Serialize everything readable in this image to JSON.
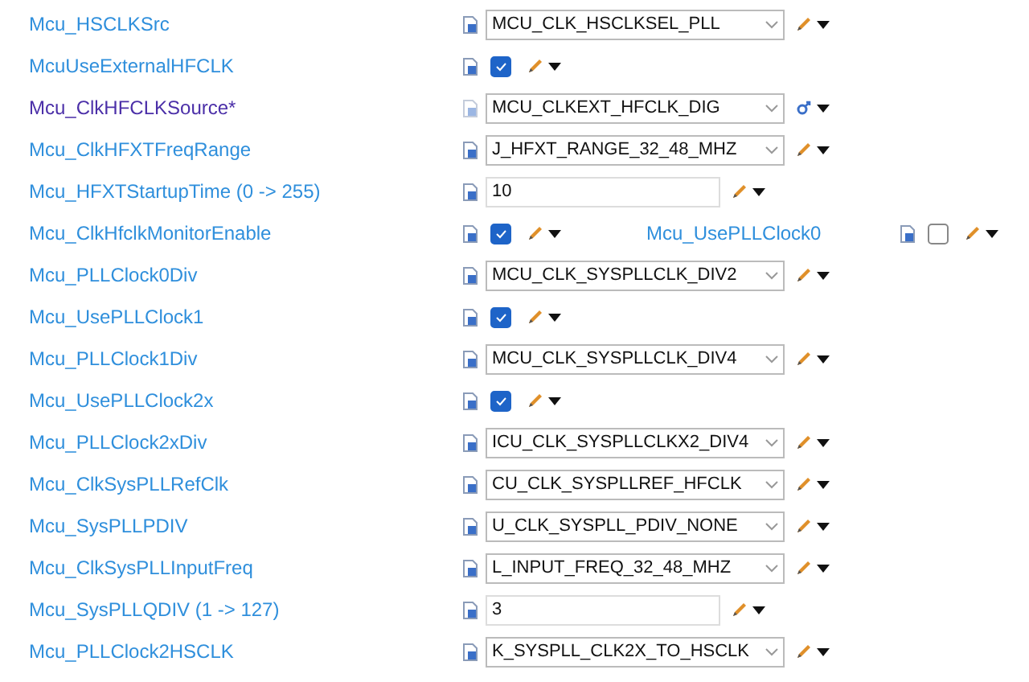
{
  "rows": [
    {
      "label": "Mcu_HSCLKSrc",
      "modified": false,
      "kind": "combo",
      "value": "MCU_CLK_HSCLKSEL_PLL",
      "linked": false
    },
    {
      "label": "McuUseExternalHFCLK",
      "modified": false,
      "kind": "check",
      "checked": true,
      "linked": false
    },
    {
      "label": "Mcu_ClkHFCLKSource*",
      "modified": true,
      "kind": "combo",
      "value": "MCU_CLKEXT_HFCLK_DIG",
      "linked": true
    },
    {
      "label": "Mcu_ClkHFXTFreqRange",
      "modified": false,
      "kind": "combo",
      "value": "J_HFXT_RANGE_32_48_MHZ",
      "linked": false
    },
    {
      "label": "Mcu_HFXTStartupTime (0 -> 255)",
      "modified": false,
      "kind": "text",
      "value": "10",
      "linked": false
    },
    {
      "label": "Mcu_ClkHfclkMonitorEnable",
      "modified": false,
      "kind": "check",
      "checked": true,
      "linked": false,
      "extra": {
        "label": "Mcu_UsePLLClock0",
        "checked": false
      }
    },
    {
      "label": "Mcu_PLLClock0Div",
      "modified": false,
      "kind": "combo",
      "value": "MCU_CLK_SYSPLLCLK_DIV2",
      "linked": false
    },
    {
      "label": "Mcu_UsePLLClock1",
      "modified": false,
      "kind": "check",
      "checked": true,
      "linked": false
    },
    {
      "label": "Mcu_PLLClock1Div",
      "modified": false,
      "kind": "combo",
      "value": "MCU_CLK_SYSPLLCLK_DIV4",
      "linked": false
    },
    {
      "label": "Mcu_UsePLLClock2x",
      "modified": false,
      "kind": "check",
      "checked": true,
      "linked": false
    },
    {
      "label": "Mcu_PLLClock2xDiv",
      "modified": false,
      "kind": "combo",
      "value": "ICU_CLK_SYSPLLCLKX2_DIV4",
      "linked": false
    },
    {
      "label": "Mcu_ClkSysPLLRefClk",
      "modified": false,
      "kind": "combo",
      "value": "CU_CLK_SYSPLLREF_HFCLK",
      "linked": false
    },
    {
      "label": "Mcu_SysPLLPDIV",
      "modified": false,
      "kind": "combo",
      "value": "U_CLK_SYSPLL_PDIV_NONE",
      "linked": false
    },
    {
      "label": "Mcu_ClkSysPLLInputFreq",
      "modified": false,
      "kind": "combo",
      "value": "L_INPUT_FREQ_32_48_MHZ",
      "linked": false
    },
    {
      "label": "Mcu_SysPLLQDIV (1 -> 127)",
      "modified": false,
      "kind": "text",
      "value": "3",
      "linked": false
    },
    {
      "label": "Mcu_PLLClock2HSCLK",
      "modified": false,
      "kind": "combo",
      "value": "K_SYSPLL_CLK2X_TO_HSCLK",
      "linked": false
    }
  ]
}
